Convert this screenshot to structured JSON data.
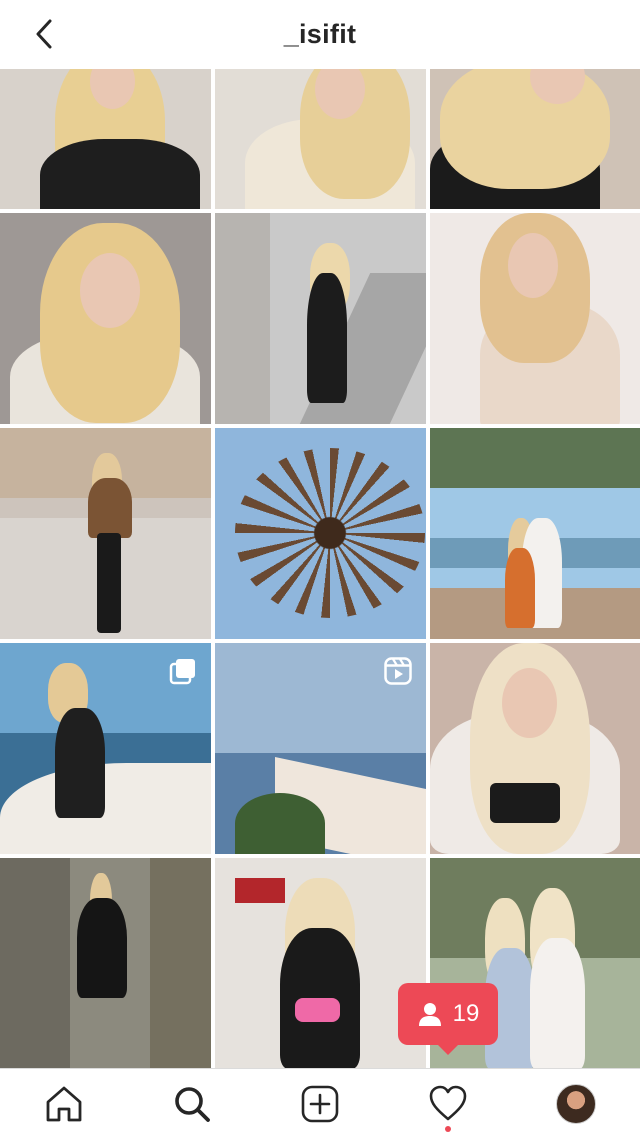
{
  "header": {
    "username": "_isifit"
  },
  "grid": {
    "posts": [
      {
        "type": "photo",
        "bg": "#d8d2cb"
      },
      {
        "type": "photo",
        "bg": "#e2ddd6"
      },
      {
        "type": "photo",
        "bg": "#cfc2b6"
      },
      {
        "type": "photo",
        "bg": "#9e9895"
      },
      {
        "type": "photo",
        "bg": "#c9c9c9"
      },
      {
        "type": "photo",
        "bg": "#efe9e6"
      },
      {
        "type": "photo",
        "bg": "#cdc4bc"
      },
      {
        "type": "photo",
        "bg": "#8fb6dc"
      },
      {
        "type": "photo",
        "bg": "#9fc8e6"
      },
      {
        "type": "carousel",
        "bg": "#6ea6cf"
      },
      {
        "type": "reel",
        "bg": "#9db8d3"
      },
      {
        "type": "photo",
        "bg": "#c9b4a8"
      },
      {
        "type": "photo",
        "bg": "#8c8a7e"
      },
      {
        "type": "photo",
        "bg": "#e6e2dd"
      },
      {
        "type": "photo",
        "bg": "#a7b49a"
      }
    ]
  },
  "activity_toast": {
    "count": "19",
    "icon": "person-icon"
  },
  "bottom_nav": [
    {
      "name": "home-icon"
    },
    {
      "name": "search-icon"
    },
    {
      "name": "new-post-icon"
    },
    {
      "name": "activity-heart-icon"
    },
    {
      "name": "profile-avatar"
    }
  ]
}
